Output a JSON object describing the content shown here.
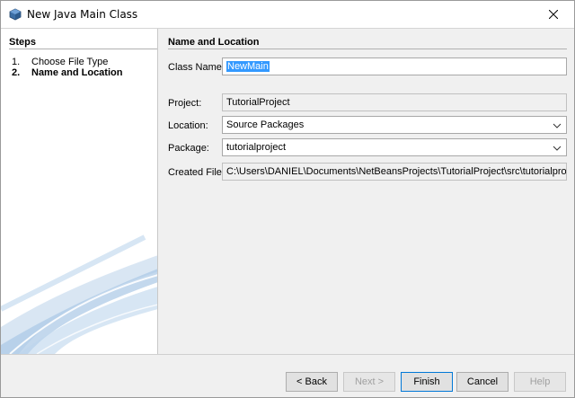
{
  "window": {
    "title": "New Java Main Class",
    "icons": {
      "app": "netbeans-cube-icon",
      "close": "close-icon"
    }
  },
  "steps": {
    "heading": "Steps",
    "items": [
      {
        "num": "1.",
        "label": "Choose File Type",
        "current": false
      },
      {
        "num": "2.",
        "label": "Name and Location",
        "current": true
      }
    ]
  },
  "form": {
    "heading": "Name and Location",
    "class_name": {
      "label": "Class Name:",
      "value": "NewMain"
    },
    "project": {
      "label": "Project:",
      "value": "TutorialProject"
    },
    "location": {
      "label": "Location:",
      "value": "Source Packages"
    },
    "package": {
      "label": "Package:",
      "value": "tutorialproject"
    },
    "created_file": {
      "label": "Created File:",
      "value": "C:\\Users\\DANIEL\\Documents\\NetBeansProjects\\TutorialProject\\src\\tutorialproject\\NewMain.java"
    }
  },
  "buttons": {
    "back": "< Back",
    "next": "Next >",
    "finish": "Finish",
    "cancel": "Cancel",
    "help": "Help"
  },
  "colors": {
    "selection": "#3399ff",
    "default_button_border": "#0078d7",
    "swoosh": "#9fc3e3"
  }
}
